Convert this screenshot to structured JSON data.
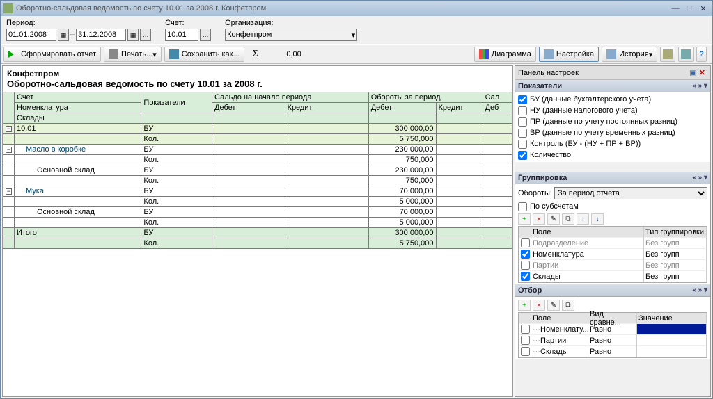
{
  "title": "Оборотно-сальдовая ведомость по счету 10.01 за 2008 г. Конфетпром",
  "params": {
    "period_label": "Период:",
    "date_from": "01.01.2008",
    "date_to": "31.12.2008",
    "account_label": "Счет:",
    "account": "10.01",
    "org_label": "Организация:",
    "org": "Конфетпром"
  },
  "toolbar": {
    "generate": "Сформировать отчет",
    "print": "Печать...",
    "save_as": "Сохранить как...",
    "total_value": "0,00",
    "chart": "Диаграмма",
    "settings": "Настройка",
    "history": "История"
  },
  "right": {
    "panel_header": "Панель настроек",
    "indicators": {
      "title": "Показатели",
      "items": [
        {
          "checked": true,
          "label": "БУ (данные бухгалтерского учета)"
        },
        {
          "checked": false,
          "label": "НУ (данные налогового учета)"
        },
        {
          "checked": false,
          "label": "ПР (данные по учету постоянных разниц)"
        },
        {
          "checked": false,
          "label": "ВР (данные по учету временных разниц)"
        },
        {
          "checked": false,
          "label": "Контроль (БУ - (НУ + ПР + ВР))"
        },
        {
          "checked": true,
          "label": "Количество"
        }
      ]
    },
    "grouping": {
      "title": "Группировка",
      "turnover_label": "Обороты:",
      "turnover_value": "За период отчета",
      "by_sub": "По субсчетам",
      "headers": {
        "field": "Поле",
        "type": "Тип группировки"
      },
      "rows": [
        {
          "checked": false,
          "enabled": false,
          "field": "Подразделение",
          "type": "Без групп"
        },
        {
          "checked": true,
          "enabled": true,
          "field": "Номенклатура",
          "type": "Без групп"
        },
        {
          "checked": false,
          "enabled": false,
          "field": "Партии",
          "type": "Без групп"
        },
        {
          "checked": true,
          "enabled": true,
          "field": "Склады",
          "type": "Без групп"
        }
      ]
    },
    "filter": {
      "title": "Отбор",
      "headers": {
        "field": "Поле",
        "cmp": "Вид сравне...",
        "val": "Значение"
      },
      "rows": [
        {
          "field": "Номенклату...",
          "cmp": "Равно"
        },
        {
          "field": "Партии",
          "cmp": "Равно"
        },
        {
          "field": "Склады",
          "cmp": "Равно"
        }
      ]
    }
  },
  "report": {
    "company": "Конфетпром",
    "title": "Оборотно-сальдовая ведомость по счету 10.01 за 2008 г.",
    "head": {
      "account": "Счет",
      "indic": "Показатели",
      "saldo_start": "Сальдо на начало периода",
      "turnover": "Обороты за период",
      "sal": "Сал",
      "nomen": "Номенклатура",
      "debit": "Дебет",
      "credit": "Кредит",
      "deb": "Деб",
      "stores": "Склады",
      "total": "Итого"
    },
    "rows": [
      {
        "lvl": 0,
        "name": "10.01",
        "ind": "БУ",
        "t_debit": "300 000,00"
      },
      {
        "lvl": 0,
        "name": "",
        "ind": "Кол.",
        "t_debit": "5 750,000"
      },
      {
        "lvl": 1,
        "name": "Масло в коробке",
        "ind": "БУ",
        "t_debit": "230 000,00"
      },
      {
        "lvl": 1,
        "name": "",
        "ind": "Кол.",
        "t_debit": "750,000"
      },
      {
        "lvl": 2,
        "name": "Основной склад",
        "ind": "БУ",
        "t_debit": "230 000,00"
      },
      {
        "lvl": 2,
        "name": "",
        "ind": "Кол.",
        "t_debit": "750,000"
      },
      {
        "lvl": 1,
        "name": "Мука",
        "ind": "БУ",
        "t_debit": "70 000,00"
      },
      {
        "lvl": 1,
        "name": "",
        "ind": "Кол.",
        "t_debit": "5 000,000"
      },
      {
        "lvl": 2,
        "name": "Основной склад",
        "ind": "БУ",
        "t_debit": "70 000,00"
      },
      {
        "lvl": 2,
        "name": "",
        "ind": "Кол.",
        "t_debit": "5 000,000"
      }
    ],
    "totals": [
      {
        "ind": "БУ",
        "t_debit": "300 000,00"
      },
      {
        "ind": "Кол.",
        "t_debit": "5 750,000"
      }
    ]
  }
}
